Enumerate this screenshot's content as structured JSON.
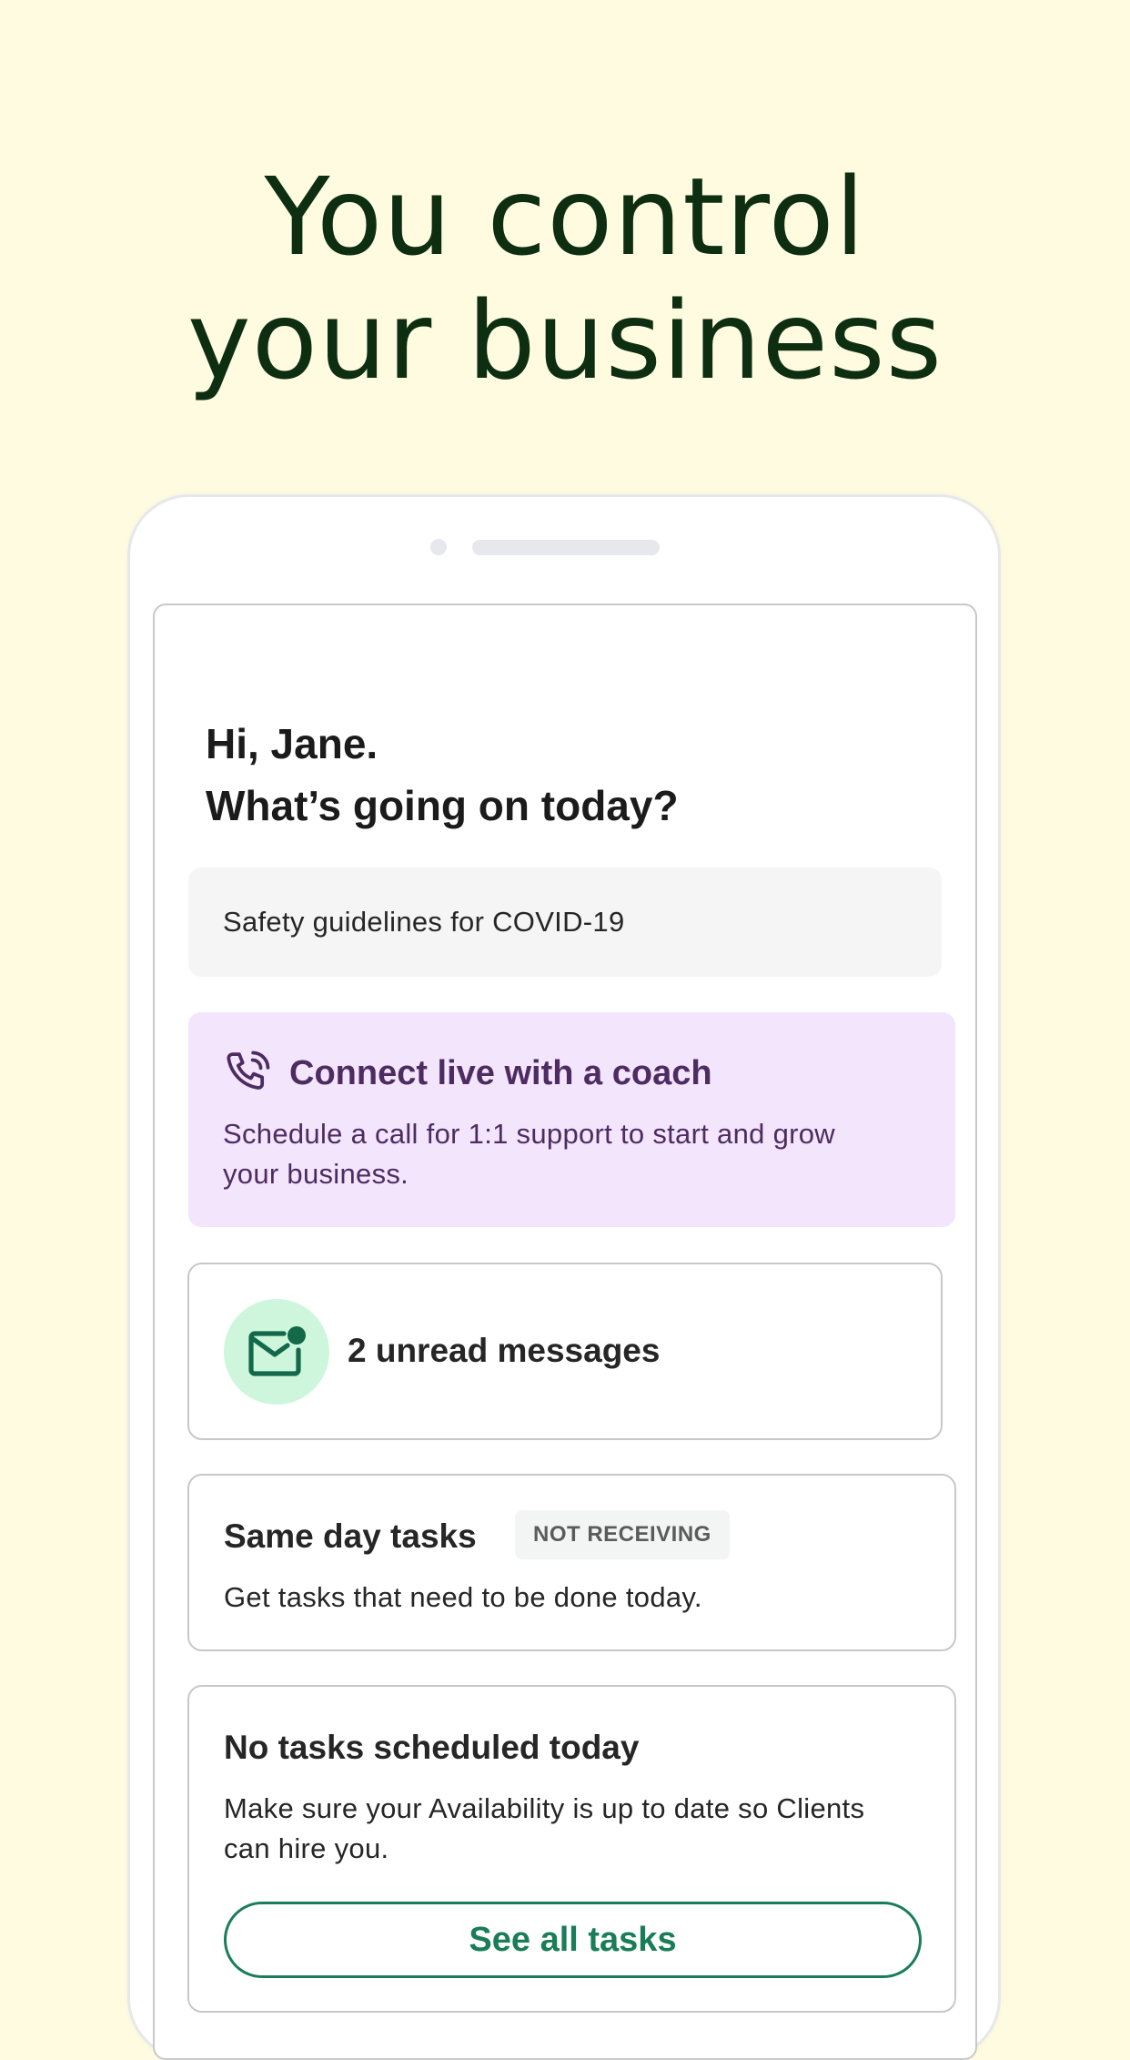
{
  "headline": {
    "line1": "You control",
    "line2": "your business"
  },
  "greeting": {
    "line1": "Hi, Jane.",
    "line2": "What’s going on today?"
  },
  "safety": {
    "label": "Safety guidelines for COVID-19"
  },
  "coach": {
    "icon": "phone-call-icon",
    "title": "Connect live with a coach",
    "body": "Schedule a call for 1:1 support to start and grow your business."
  },
  "messages": {
    "icon": "mail-icon",
    "label": "2 unread messages"
  },
  "same_day": {
    "title": "Same day tasks",
    "badge": "NOT RECEIVING",
    "body": "Get tasks that need to be done today."
  },
  "no_tasks": {
    "title": "No tasks scheduled today",
    "body": "Make sure your Availability is up to date so Clients can hire you.",
    "button": "See all tasks"
  },
  "colors": {
    "background": "#fffbe0",
    "headline": "#0e2e12",
    "coach_bg": "#f3e5fc",
    "coach_text": "#4d2c62",
    "mail_circle": "#cdf6dd",
    "accent_green": "#1a7d5a"
  }
}
